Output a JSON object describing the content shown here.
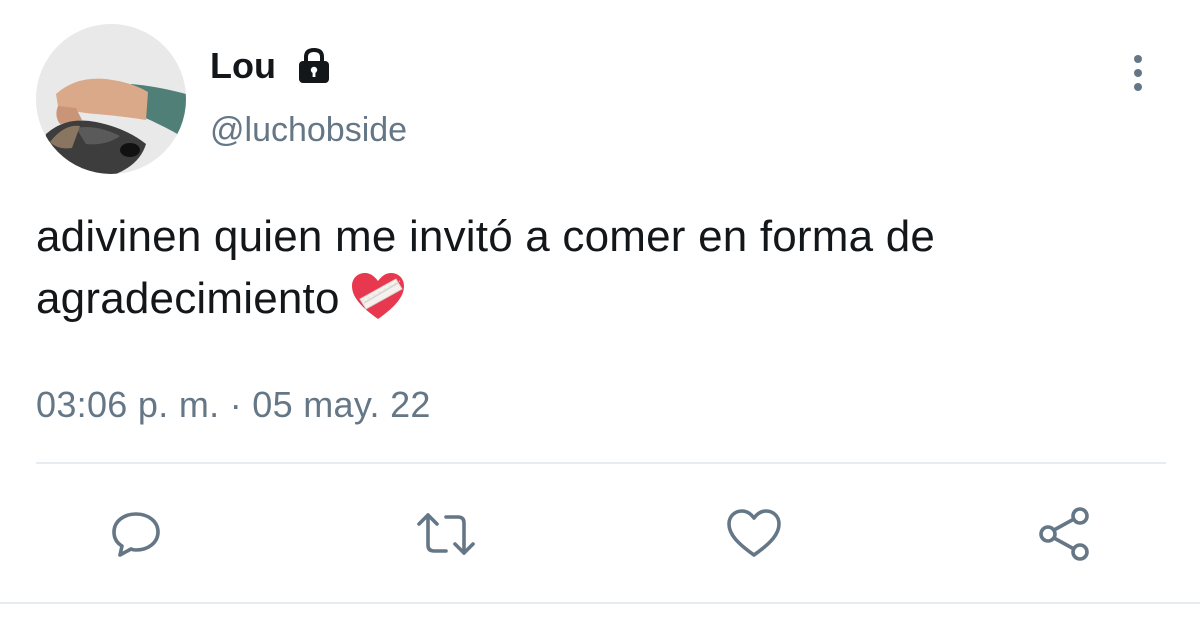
{
  "tweet": {
    "display_name": "Lou",
    "handle": "@luchobside",
    "text": "adivinen quien me invitó a comer en forma de agradecimiento",
    "emoji": "mending-heart-emoji",
    "timestamp": "03:06 p. m. · 05 may. 22"
  },
  "icons": {
    "lock": "lock-icon",
    "more": "more-vertical-icon",
    "reply": "reply-icon",
    "retweet": "retweet-icon",
    "like": "heart-icon",
    "share": "share-icon"
  },
  "colors": {
    "text": "#14171a",
    "secondary": "#657786",
    "divider": "#e6ecf0",
    "emoji_heart": "#e8384f"
  }
}
